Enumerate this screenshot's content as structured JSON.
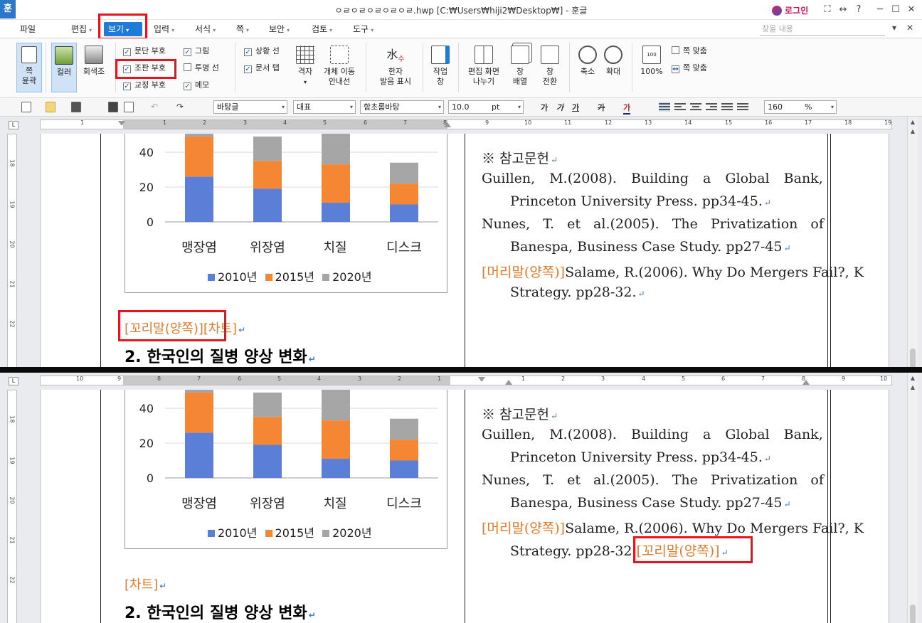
{
  "app": {
    "icon": "훈",
    "title": "ㅇㄹㅇㄹㅇㄹㅇㄹㅇㄹ.hwp [C:₩Users₩hiji2₩Desktop₩] - 훈글",
    "login": "로그인",
    "controls": [
      "⛶",
      "↔",
      "?",
      "─",
      "☐",
      "✕"
    ]
  },
  "menu": {
    "items": [
      "파일",
      "편집",
      "보기",
      "입력",
      "서식",
      "쪽",
      "보안",
      "검토",
      "도구"
    ],
    "find_placeholder": "찾을 내용",
    "controls": [
      "▾",
      "✕"
    ]
  },
  "ribbon": {
    "page_outline": "쪽\n윤곽",
    "color": "컬러",
    "grayscale": "회색조",
    "checks": [
      {
        "label": "문단 부호",
        "checked": true
      },
      {
        "label": "조판 부호",
        "checked": true
      },
      {
        "label": "교정 부호",
        "checked": true
      },
      {
        "label": "그림",
        "checked": true
      },
      {
        "label": "투명 선",
        "checked": false
      },
      {
        "label": "메모",
        "checked": true
      },
      {
        "label": "상황 선",
        "checked": true
      },
      {
        "label": "문서 탭",
        "checked": true
      }
    ],
    "grid": "격자",
    "object_move": "개체 이동\n안내선",
    "hanja": "한자\n발음 표시",
    "work_window": "작업\n창",
    "split_screen": "편집 화면\n나누기",
    "arrange": "창\n배열",
    "switch": "창\n전환",
    "zoom_out": "축소",
    "zoom_in": "확대",
    "zoom_100": "100%",
    "fit_page": "쪽 맞춤",
    "fit_width": "쪽 맞춤"
  },
  "toolbar": {
    "style": "바탕글",
    "shape": "대표",
    "font": "함초롬바탕",
    "size": "10.0",
    "unit": "pt",
    "fmt": [
      "가",
      "가",
      "가",
      "가",
      "가"
    ],
    "zoom": "160",
    "zoom_unit": "%"
  },
  "ruler_top": {
    "left_nums": [
      "1",
      "1",
      "2",
      "3",
      "4",
      "5",
      "6",
      "7",
      "8"
    ],
    "right_nums": [
      "9",
      "10",
      "11",
      "12",
      "13",
      "14",
      "15",
      "16",
      "17",
      "18",
      "19"
    ]
  },
  "ruler_bottom": {
    "nums": [
      "10",
      "9",
      "8",
      "7",
      "6",
      "5",
      "4",
      "3",
      "2",
      "1",
      "1",
      "2",
      "3",
      "4",
      "5",
      "6",
      "7",
      "8",
      "9",
      "10"
    ]
  },
  "vruler": {
    "top": [
      "18",
      "19",
      "20",
      "21",
      "22"
    ],
    "bottom": [
      "18",
      "19",
      "20",
      "21",
      "22"
    ]
  },
  "chart_data": {
    "type": "bar",
    "stacked": true,
    "categories": [
      "맹장염",
      "위장염",
      "치질",
      "디스크"
    ],
    "series": [
      {
        "name": "2010년",
        "color": "#5b7fd6",
        "values": [
          26,
          19,
          11,
          10
        ]
      },
      {
        "name": "2015년",
        "color": "#f58634",
        "values": [
          23,
          16,
          22,
          12
        ]
      },
      {
        "name": "2020년",
        "color": "#a6a6a6",
        "values": [
          10,
          14,
          19,
          12
        ]
      }
    ],
    "yticks": [
      "0",
      "20",
      "40"
    ],
    "ylim": [
      0,
      60
    ]
  },
  "doc_left": {
    "tag_top": "[꼬리말(양쪽)]",
    "tag_chart": "[차트]",
    "heading": "2. 한국인의 질병 양상 변화"
  },
  "doc_right": {
    "ref_title": "※ 참고문헌",
    "line1": "Guillen, M.(2008). Building a Global Bank,",
    "line2": "Princeton University Press. pp34-45.",
    "line3": "Nunes, T. et al.(2005). The Privatization of",
    "line4": "Banespa, Business Case Study. pp27-45",
    "tag_header": "[머리말(양쪽)]",
    "line5": "Salame, R.(2006). Why Do Mergers Fail?, K",
    "line6": "Strategy. pp28-32.",
    "tag_footer": "[꼬리말(양쪽)]"
  }
}
